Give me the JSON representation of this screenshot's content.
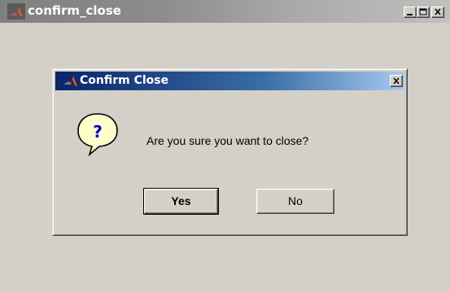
{
  "window": {
    "title": "confirm_close",
    "icon": "matlab-icon",
    "controls": [
      "minimize-icon",
      "maximize-icon",
      "close-icon"
    ]
  },
  "dialog": {
    "title": "Confirm Close",
    "icon": "matlab-icon",
    "close_icon": "close-icon",
    "question_icon": "question-balloon-icon",
    "message": "Are you sure you want to close?",
    "yes_label": "Yes",
    "no_label": "No"
  },
  "colors": {
    "window_bg": "#d4d0c8",
    "inactive_titlebar": "#808080",
    "active_titlebar": "#0a246a",
    "question_balloon": "#ffffcc"
  }
}
